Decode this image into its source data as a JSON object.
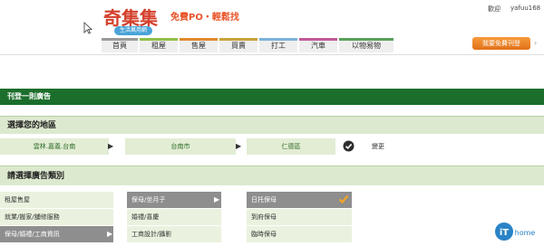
{
  "header": {
    "logo_text": "奇集集",
    "logo_badge": "生活萬用網",
    "slogan": "免費PO・輕鬆找",
    "welcome": "歡迎",
    "username": "yafuu168",
    "free_post": "我要免費刊登"
  },
  "nav": {
    "tabs": [
      {
        "label": "首頁",
        "color": "#9a9a9a"
      },
      {
        "label": "租屋",
        "color": "#8fbf4a"
      },
      {
        "label": "售屋",
        "color": "#e08a2c"
      },
      {
        "label": "買賣",
        "color": "#c9a23a"
      },
      {
        "label": "打工",
        "color": "#7bb3d9"
      },
      {
        "label": "汽車",
        "color": "#c05a9a"
      },
      {
        "label": "以物易物",
        "color": "#5aa05a"
      }
    ]
  },
  "sections": {
    "post_title": "刊登一則廣告",
    "region_title": "選擇您的地區",
    "category_title": "請選擇廣告類別"
  },
  "region": {
    "area": "雲林.嘉義.台南",
    "city": "台南市",
    "district": "仁德區",
    "change": "變更"
  },
  "categories": {
    "col1": [
      "租屋售屋",
      "就業/搬家/舖修服務",
      "保母/婚禮/工商資訊"
    ],
    "col2": [
      "保母/坐月子",
      "婚禮/喜慶",
      "工商設計/攝影"
    ],
    "col3": [
      "日托保母",
      "到府保母",
      "臨時保母"
    ]
  },
  "brand": {
    "ithome_logo": "iThome"
  }
}
